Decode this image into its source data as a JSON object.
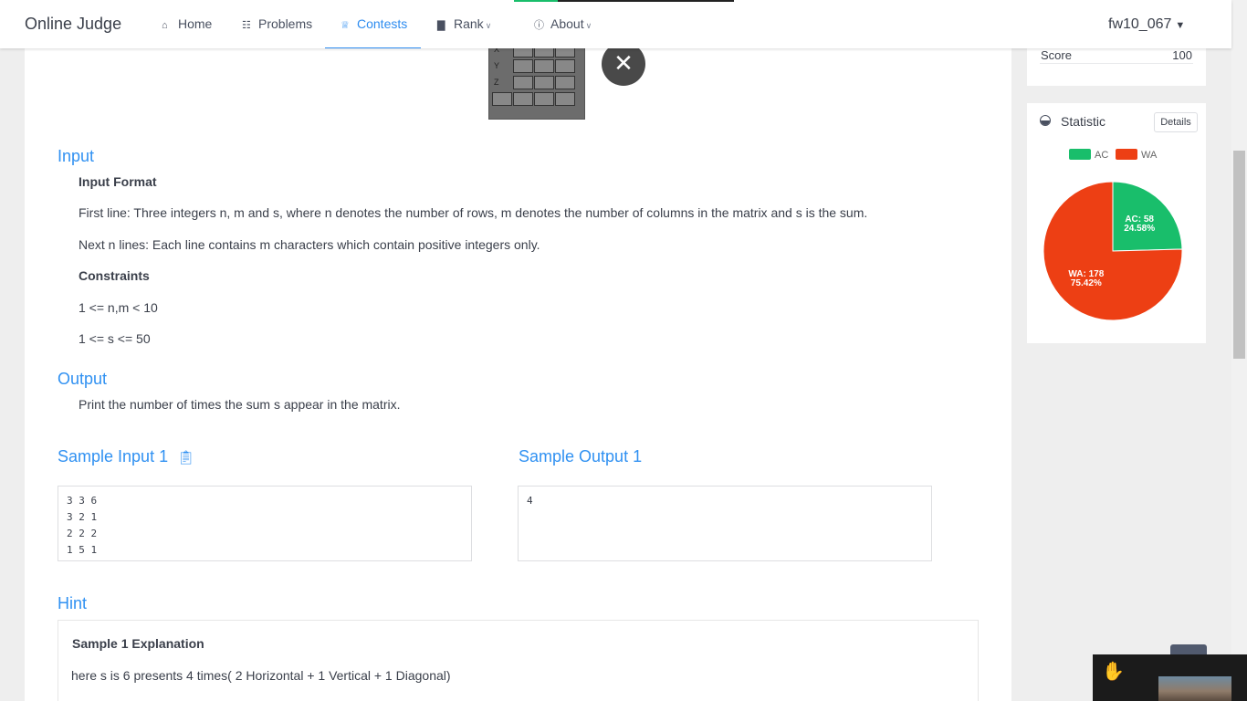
{
  "nav": {
    "brand": "Online Judge",
    "items": [
      {
        "label": "Home",
        "icon": "home-icon"
      },
      {
        "label": "Problems",
        "icon": "grid-icon"
      },
      {
        "label": "Contests",
        "icon": "trophy-icon"
      },
      {
        "label": "Rank",
        "icon": "bar-chart-icon"
      },
      {
        "label": "About",
        "icon": "info-icon"
      }
    ],
    "active": "Contests",
    "user": "fw10_067"
  },
  "image": {
    "row_labels": [
      "X",
      "Y",
      "Z"
    ]
  },
  "problem": {
    "input_title": "Input",
    "input_format_heading": "Input Format",
    "input_line1": "First line: Three integers n, m and s, where n denotes the number of rows, m denotes the number of columns in the matrix and s is the sum.",
    "input_line2": "Next n lines: Each line contains m characters which contain positive integers only.",
    "constraints_heading": "Constraints",
    "constraint1": "1 <= n,m < 10",
    "constraint2": "1 <= s <= 50",
    "output_title": "Output",
    "output_text": "Print the number of times the sum s appear in the matrix.",
    "sample_input_title": "Sample Input 1",
    "sample_input": "3 3 6\n3 2 1\n2 2 2\n1 5 1",
    "sample_output_title": "Sample Output 1",
    "sample_output": "4",
    "hint_title": "Hint",
    "hint_heading": "Sample 1 Explanation",
    "hint_text": "here s is 6 presents 4 times( 2 Horizontal + 1 Vertical + 1 Diagonal)"
  },
  "sidebar": {
    "score_label": "Score",
    "score_value": "100",
    "statistic_title": "Statistic",
    "details_label": "Details"
  },
  "chart_data": {
    "type": "pie",
    "categories": [
      "AC",
      "WA"
    ],
    "values": [
      58,
      178
    ],
    "percentages": [
      "24.58%",
      "75.42%"
    ],
    "labels": [
      "AC: 58",
      "WA: 178"
    ],
    "colors": [
      "#19be6b",
      "#ed3f14"
    ],
    "legend_position": "top"
  }
}
